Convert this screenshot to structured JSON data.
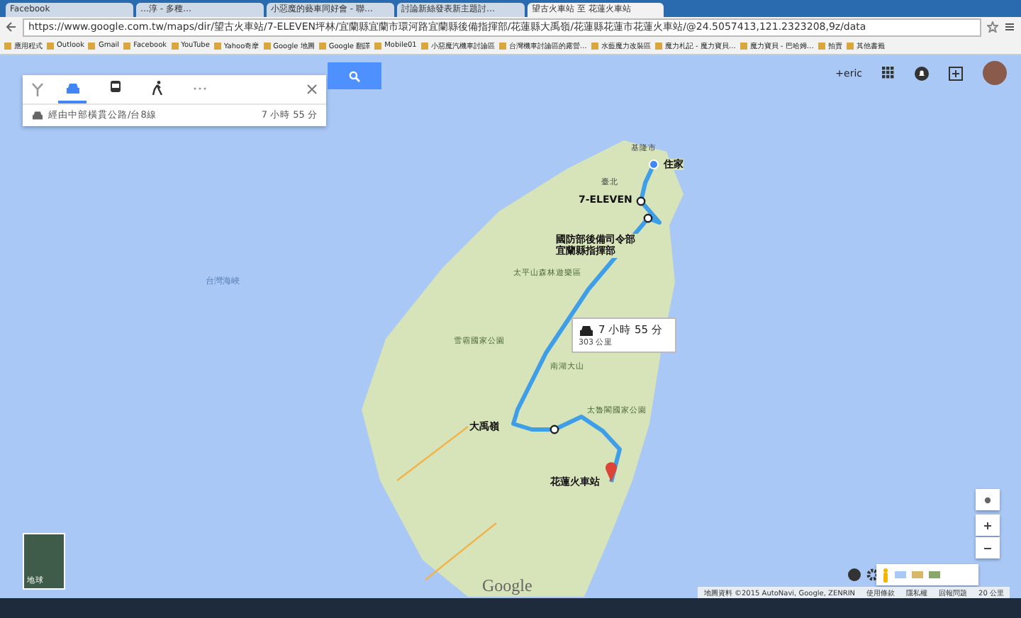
{
  "browser": {
    "tabs": [
      {
        "title": "Facebook",
        "selected": false
      },
      {
        "title": "…淳 - 多種…",
        "selected": false
      },
      {
        "title": "小惡魔的藝車同好會 - 聯…",
        "selected": false
      },
      {
        "title": "討論新絲發表新主題討…",
        "selected": false
      },
      {
        "title": "望古火車站 至 花蓮火車站",
        "selected": true
      }
    ],
    "url": "https://www.google.com.tw/maps/dir/望古火車站/7-ELEVEN坪林/宜蘭縣宜蘭市環河路宜蘭縣後備指揮部/花蓮縣大禹嶺/花蓮縣花蓮市花蓮火車站/@24.5057413,121.2323208,9z/data",
    "bookmarks": [
      "應用程式",
      "Outlook",
      "Gmail",
      "Facebook",
      "YouTube",
      "Yahoo奇摩",
      "Google 地圖",
      "Google 翻譯",
      "Mobile01",
      "小惡魔汽機車討論區",
      "台灣機車討論區的露營…",
      "水藍魔力改裝區",
      "魔力札記 - 魔力寶貝…",
      "魔力寶貝 - 巴哈姆…",
      "拍賣",
      "其他書籤"
    ]
  },
  "directions": {
    "modes": [
      {
        "kind": "car",
        "selected": true
      },
      {
        "kind": "transit",
        "selected": false
      },
      {
        "kind": "walk",
        "selected": false
      },
      {
        "kind": "more",
        "selected": false
      }
    ],
    "route": {
      "via": "經由中部橫貫公路/台8線",
      "time": "7 小時 55 分"
    }
  },
  "account": {
    "user": "+eric"
  },
  "map": {
    "labels": [
      {
        "text": "台灣海峽",
        "kind": "sea"
      },
      {
        "text": "基隆市",
        "kind": "place"
      },
      {
        "text": "臺北",
        "kind": "place"
      },
      {
        "text": "雪霸國家公園",
        "kind": "park"
      },
      {
        "text": "南湖大山",
        "kind": "park"
      },
      {
        "text": "太平山森林遊樂區",
        "kind": "park"
      },
      {
        "text": "太魯閣國家公園",
        "kind": "park"
      }
    ],
    "waypoints": [
      {
        "name": "住家",
        "kind": "start"
      },
      {
        "name": "7-ELEVEN",
        "kind": "stop"
      },
      {
        "name": "國防部後備司令部宜蘭縣指揮部",
        "kind": "stop"
      },
      {
        "name": "大禹嶺",
        "kind": "stop"
      },
      {
        "name": "花蓮火車站",
        "kind": "end"
      }
    ],
    "route_box": {
      "time": "7 小時 55 分",
      "distance": "303 公里"
    },
    "earth": {
      "label": "地球"
    },
    "logo": "Google",
    "footer": [
      "地圖資料 ©2015 AutoNavi, Google, ZENRIN",
      "使用條款",
      "隱私權",
      "回報問題",
      "20 公里"
    ]
  }
}
